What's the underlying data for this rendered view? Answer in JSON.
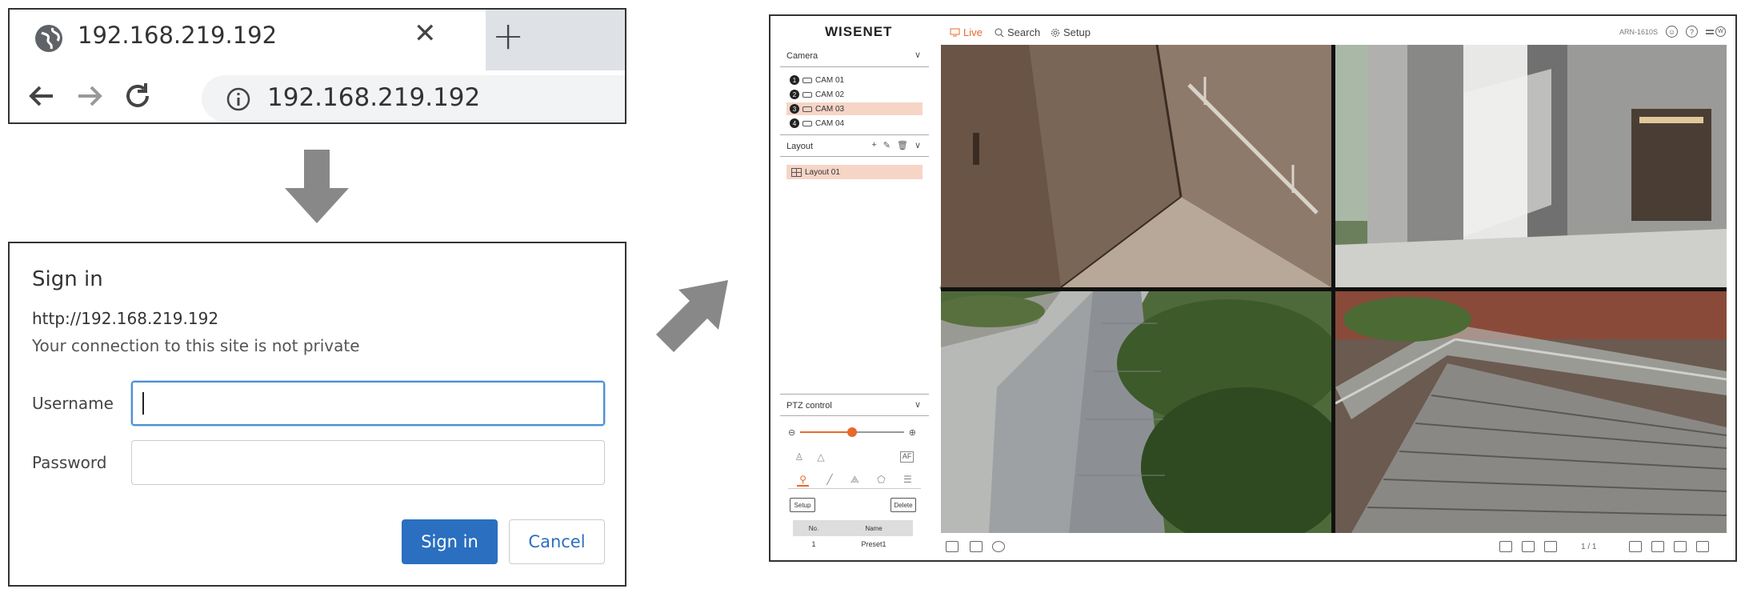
{
  "browser": {
    "tab_title": "192.168.219.192",
    "close_glyph": "✕",
    "newtab_glyph": "+",
    "url": "192.168.219.192",
    "icons": [
      "globe-icon",
      "close-icon",
      "plus-icon",
      "back-icon",
      "forward-icon",
      "reload-icon",
      "info-icon"
    ]
  },
  "signin": {
    "heading": "Sign in",
    "site": "http://192.168.219.192",
    "warning": "Your connection to this site is not private",
    "username_label": "Username",
    "username_value": "",
    "password_label": "Password",
    "password_value": "",
    "signin_button": "Sign in",
    "cancel_button": "Cancel"
  },
  "wisenet": {
    "logo": "WISENET",
    "menu": {
      "live": "Live",
      "search": "Search",
      "setup": "Setup"
    },
    "model": "ARN-1610S",
    "user_badge": "W",
    "camera_section": "Camera",
    "cameras": [
      {
        "num": "1",
        "name": "CAM 01",
        "selected": false
      },
      {
        "num": "2",
        "name": "CAM 02",
        "selected": false
      },
      {
        "num": "3",
        "name": "CAM 03",
        "selected": true
      },
      {
        "num": "4",
        "name": "CAM 04",
        "selected": false
      }
    ],
    "layout_section": "Layout",
    "layout_item": "Layout 01",
    "ptz": {
      "title": "PTZ control",
      "zoom_level": 0.5,
      "af_label": "AF",
      "setup_button": "Setup",
      "delete_button": "Delete",
      "table_headers": [
        "No.",
        "Name"
      ],
      "presets": [
        {
          "no": "1",
          "name": "Preset1"
        }
      ]
    },
    "page_indicator": "1 / 1",
    "accent_color": "#e8682c",
    "selected_bg": "#f6d5c6"
  }
}
